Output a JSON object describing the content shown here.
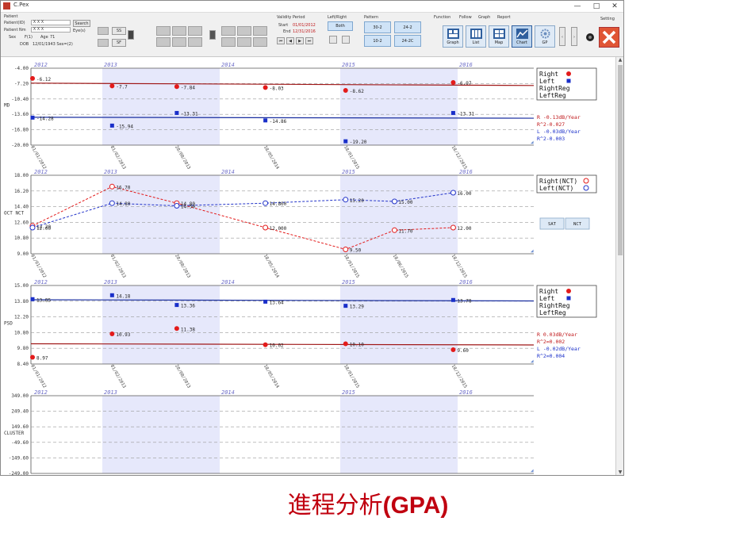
{
  "window": {
    "title": "C.Pex",
    "controls": {
      "minimize": "—",
      "maximize": "□",
      "close": "✕"
    }
  },
  "toolbar": {
    "patient_label": "Patient",
    "patient_id_label": "Patient(ID)",
    "patient_id_value": "ＸＸＸ",
    "patient_name_label": "Patient Nm",
    "patient_name_value": "ＸＸＸ",
    "search_label": "Search",
    "eye_label": "Eye(s)",
    "sex_label": "Sex",
    "sex_value": "F(1)",
    "age_label": "Age",
    "age_value": "71",
    "dob_label": "DOB",
    "dob_value": "12/01/1943 Sex=(2)",
    "top_small_left": "SS",
    "top_small_right": "SF",
    "reliability_label": "Validity Period",
    "start_label": "Start",
    "start_value": "01/01/2012",
    "end_label": "End",
    "end_value": "12/31/2016",
    "nav_buttons": [
      "⏮",
      "◀",
      "▶",
      "⏭"
    ],
    "lr_label": "Left/Right",
    "lr_value": "Both",
    "pattern_label": "Pattern",
    "pattern_buttons": [
      "30-2",
      "24-2",
      "10-2",
      "24-2C"
    ],
    "function_label": "Function",
    "function_tabs": [
      "Follow",
      "Graph",
      "Report"
    ],
    "view_buttons": [
      "Graph",
      "List",
      "Map",
      "Chart",
      "GP"
    ],
    "setting_label": "Setting"
  },
  "chart_data": [
    {
      "type": "line",
      "name": "MD",
      "ylabel": "MD",
      "yticks": [
        "-4.00",
        "-7.20",
        "-10.40",
        "-13.60",
        "-16.80",
        "-20.00"
      ],
      "ylim": [
        -20,
        -4
      ],
      "years": [
        "2012",
        "2013",
        "2014",
        "2015",
        "2016"
      ],
      "dates": [
        "01/01/2012",
        "01/02/2013",
        "20/08/2013",
        "18/05/2014",
        "18/01/2015",
        "18/12/2015"
      ],
      "legend": [
        "Right",
        "Left",
        "RightReg",
        "LeftReg"
      ],
      "series": [
        {
          "name": "Right",
          "color": "#e31b1b",
          "marker": "dot",
          "points": [
            [
              "01/01/2012",
              -6.12
            ],
            [
              "01/02/2013",
              -7.7
            ],
            [
              "20/08/2013",
              -7.84
            ],
            [
              "18/05/2014",
              -8.03
            ],
            [
              "18/01/2015",
              -8.62
            ],
            [
              "18/12/2015",
              -6.97
            ]
          ],
          "labels": [
            "-6.12",
            "-7.7",
            "-7.84",
            "-8.03",
            "-8.62",
            "-6.97"
          ]
        },
        {
          "name": "Left",
          "color": "#1a2fc9",
          "marker": "square",
          "points": [
            [
              "01/01/2012",
              -14.28
            ],
            [
              "01/02/2013",
              -15.94
            ],
            [
              "20/08/2013",
              -13.31
            ],
            [
              "18/05/2014",
              -14.86
            ],
            [
              "18/01/2015",
              -19.2
            ],
            [
              "18/12/2015",
              -13.31
            ]
          ],
          "labels": [
            "-14.28",
            "-15.94",
            "-13.31",
            "-14.86",
            "-19.20",
            "-13.31"
          ]
        }
      ],
      "regressions": [
        {
          "name": "RightReg",
          "color": "#a01818",
          "from": -7.1,
          "to": -7.6
        },
        {
          "name": "LeftReg",
          "color": "#1a2fa0",
          "from": -14.2,
          "to": -14.4
        }
      ],
      "notes": [
        {
          "text": "R -0.13dB/Year",
          "color": "#c0181b"
        },
        {
          "text": "R^2-0.027",
          "color": "#c0181b"
        },
        {
          "text": "L -0.03dB/Year",
          "color": "#1a2fc9"
        },
        {
          "text": "R^2-0.003",
          "color": "#1a2fc9"
        }
      ]
    },
    {
      "type": "line",
      "name": "OCT",
      "ylabel": "OCT NCT",
      "yticks": [
        "18.00",
        "16.20",
        "14.40",
        "12.60",
        "10.80",
        "9.00"
      ],
      "ylim": [
        9,
        18
      ],
      "years": [
        "2012",
        "2013",
        "2014",
        "2015",
        "2016"
      ],
      "dates": [
        "01/01/2012",
        "01/02/2013",
        "20/08/2013",
        "18/05/2014",
        "18/01/2015",
        "18/06/2015",
        "18/12/2015"
      ],
      "legend": [
        "Right(NCT)",
        "Left(NCT)"
      ],
      "series": [
        {
          "name": "Right(NCT)",
          "color": "#e31b1b",
          "marker": "circle",
          "points": [
            [
              "01/01/2012",
              12.2
            ],
            [
              "01/02/2013",
              16.7
            ],
            [
              "20/08/2013",
              14.8
            ],
            [
              "18/05/2014",
              12.0
            ],
            [
              "18/01/2015",
              9.5
            ],
            [
              "18/06/2015",
              11.7
            ],
            [
              "18/12/2015",
              12.0
            ]
          ],
          "labels": [
            "12.20",
            "16.70",
            "14.80",
            "12.000",
            "9.50",
            "11.70",
            "12.00"
          ]
        },
        {
          "name": "Left(NCT)",
          "color": "#2233c9",
          "marker": "circle",
          "points": [
            [
              "01/01/2012",
              12.0
            ],
            [
              "01/02/2013",
              14.8
            ],
            [
              "20/08/2013",
              14.5
            ],
            [
              "18/05/2014",
              14.8
            ],
            [
              "18/01/2015",
              15.2
            ],
            [
              "18/06/2015",
              15.0
            ],
            [
              "18/12/2015",
              16.0
            ]
          ],
          "labels": [
            "12.00",
            "14.80",
            "14.50",
            "14.800",
            "15.20",
            "15.00",
            "16.00"
          ]
        }
      ],
      "buttons": [
        "SAT",
        "NCT"
      ]
    },
    {
      "type": "line",
      "name": "PSD",
      "ylabel": "PSD",
      "yticks": [
        "15.00",
        "13.80",
        "12.20",
        "10.80",
        "9.80",
        "8.40"
      ],
      "ylim": [
        8.4,
        15
      ],
      "years": [
        "2012",
        "2013",
        "2014",
        "2015",
        "2016"
      ],
      "dates": [
        "01/01/2012",
        "01/02/2013",
        "20/08/2013",
        "18/05/2014",
        "18/01/2015",
        "18/12/2015"
      ],
      "legend": [
        "Right",
        "Left",
        "RightReg",
        "LeftReg"
      ],
      "series": [
        {
          "name": "Right",
          "color": "#e31b1b",
          "marker": "dot",
          "points": [
            [
              "01/01/2012",
              8.97
            ],
            [
              "01/02/2013",
              10.93
            ],
            [
              "20/08/2013",
              11.38
            ],
            [
              "18/05/2014",
              10.02
            ],
            [
              "18/01/2015",
              10.1
            ],
            [
              "18/12/2015",
              9.6
            ]
          ],
          "labels": [
            "8.97",
            "10.93",
            "11.38",
            "10.02",
            "10.10",
            "9.60"
          ]
        },
        {
          "name": "Left",
          "color": "#1a2fc9",
          "marker": "square",
          "points": [
            [
              "01/01/2012",
              13.85
            ],
            [
              "01/02/2013",
              14.18
            ],
            [
              "20/08/2013",
              13.36
            ],
            [
              "18/05/2014",
              13.64
            ],
            [
              "18/01/2015",
              13.29
            ],
            [
              "18/12/2015",
              13.78
            ]
          ],
          "labels": [
            "13.85",
            "14.18",
            "13.36",
            "13.64",
            "13.29",
            "13.78"
          ]
        }
      ],
      "regressions": [
        {
          "name": "RightReg",
          "color": "#a01818",
          "from": 10.1,
          "to": 10.0
        },
        {
          "name": "LeftReg",
          "color": "#1a2fa0",
          "from": 13.8,
          "to": 13.7
        }
      ],
      "notes": [
        {
          "text": "R 0.03dB/Year",
          "color": "#c0181b"
        },
        {
          "text": "R^2=0.002",
          "color": "#c0181b"
        },
        {
          "text": "L -0.02dB/Year",
          "color": "#1a2fc9"
        },
        {
          "text": "R^2=0.004",
          "color": "#1a2fc9"
        }
      ]
    },
    {
      "type": "line",
      "name": "CLUSTER",
      "ylabel": "CLUSTER",
      "yticks": [
        "349.00",
        "249.40",
        "149.60",
        "-49.60",
        "-149.60",
        "-249.00"
      ],
      "ylim": [
        -249,
        349
      ],
      "years": [
        "2012",
        "2013",
        "2014",
        "2015",
        "2016"
      ],
      "series": []
    }
  ],
  "caption": {
    "cjk": "進程分析",
    "gpa": "(GPA)"
  }
}
